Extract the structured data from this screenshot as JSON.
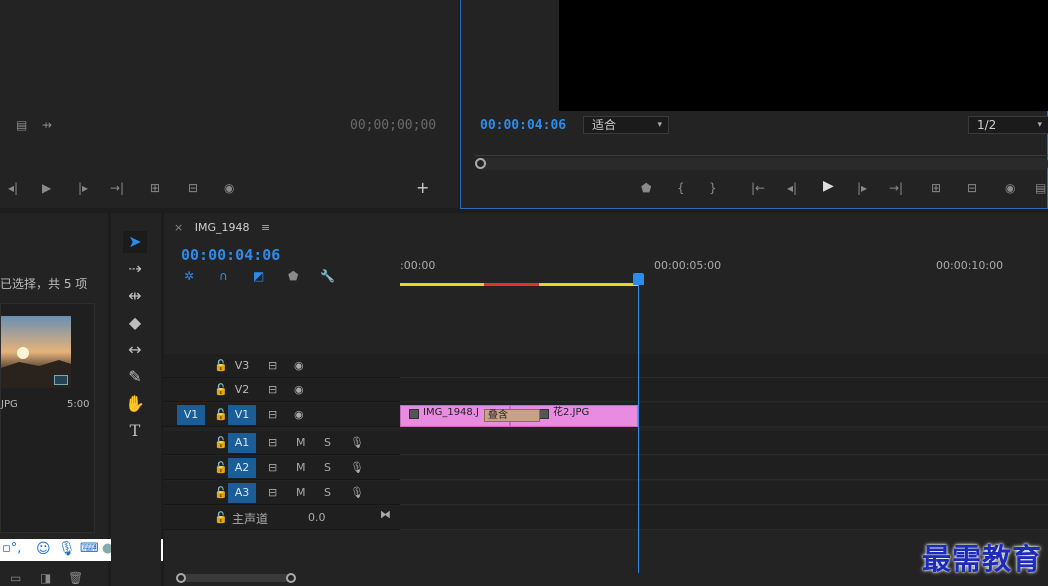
{
  "source_monitor": {
    "timecode": "00;00;00;00"
  },
  "program_monitor": {
    "timecode": "00:00:04:06",
    "fit_option": "适合",
    "resolution": "1/2"
  },
  "project": {
    "selection_status": "已选择，共 5 项",
    "item": {
      "name": "JPG",
      "duration": "5:00"
    }
  },
  "timeline": {
    "sequence_name": "IMG_1948",
    "timecode": "00:00:04:06",
    "ruler_labels": [
      ":00:00",
      "00:00:05:00",
      "00:00:10:00"
    ],
    "video_tracks": [
      {
        "patch": "",
        "name": "V3"
      },
      {
        "patch": "",
        "name": "V2"
      },
      {
        "patch": "V1",
        "name": "V1"
      }
    ],
    "audio_tracks": [
      {
        "name": "A1",
        "mute": "M",
        "solo": "S"
      },
      {
        "name": "A2",
        "mute": "M",
        "solo": "S"
      },
      {
        "name": "A3",
        "mute": "M",
        "solo": "S"
      }
    ],
    "master": {
      "label": "主声道",
      "value": "0.0"
    },
    "clips": [
      {
        "name": "IMG_1948.J"
      },
      {
        "name": "花2.JPG"
      }
    ],
    "transition": "叠含"
  },
  "watermark": "最需教育",
  "colors": {
    "accent": "#2d8ceb",
    "clip": "#e98be0",
    "track_active": "#1a5d97",
    "workarea": "#e8d32a"
  }
}
